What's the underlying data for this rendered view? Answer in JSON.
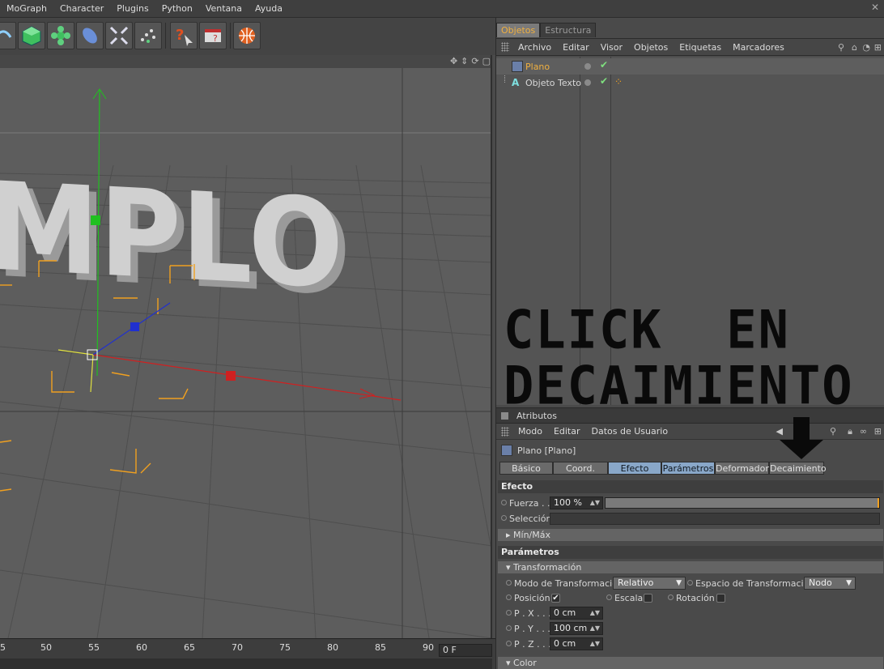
{
  "menubar": {
    "items": [
      "MoGraph",
      "Character",
      "Plugins",
      "Python",
      "Ventana",
      "Ayuda"
    ]
  },
  "viewport": {
    "scene_text": "MPLO"
  },
  "timeline": {
    "ticks": [
      "5",
      "50",
      "55",
      "60",
      "65",
      "70",
      "75",
      "80",
      "85",
      "90"
    ],
    "current_frame": "0 F"
  },
  "object_manager": {
    "tabs": [
      "Objetos",
      "Estructura"
    ],
    "menu": [
      "Archivo",
      "Editar",
      "Visor",
      "Objetos",
      "Etiquetas",
      "Marcadores"
    ],
    "objects": [
      {
        "name": "Plano",
        "color": "#f0b040"
      },
      {
        "name": "Objeto Texto",
        "color": "#d8d8d8"
      }
    ]
  },
  "annotation": {
    "line1": "CLICK  EN",
    "line2": "DECAIMIENTO"
  },
  "attributes": {
    "title": "Atributos",
    "menu": [
      "Modo",
      "Editar",
      "Datos de Usuario"
    ],
    "object_label": "Plano [Plano]",
    "tabs": [
      "Básico",
      "Coord.",
      "Efecto",
      "Parámetros",
      "Deformador",
      "Decaimiento"
    ],
    "efecto": {
      "header": "Efecto",
      "fuerza_label": "Fuerza . .",
      "fuerza_value": "100 %",
      "fuerza_level": 1.0,
      "seleccion_label": "Selección",
      "minmax_label": "Mín/Máx"
    },
    "parametros": {
      "header": "Parámetros",
      "transformacion_label": "Transformación",
      "modo_label": "Modo de Transformación",
      "modo_value": "Relativo",
      "espacio_label": "Espacio de Transformación",
      "espacio_value": "Nodo",
      "posicion_label": "Posición",
      "escala_label": "Escala",
      "rotacion_label": "Rotación",
      "px_label": "P . X . . .",
      "px_value": "0 cm",
      "py_label": "P . Y . . .",
      "py_value": "100 cm",
      "pz_label": "P . Z . . .",
      "pz_value": "0 cm",
      "color_label": "Color"
    }
  },
  "colors": {
    "axis_x": "#d02020",
    "axis_y": "#20c020",
    "axis_z": "#2030d0",
    "falloff": "#f0a020",
    "tab_selected": "#89a7c8"
  }
}
